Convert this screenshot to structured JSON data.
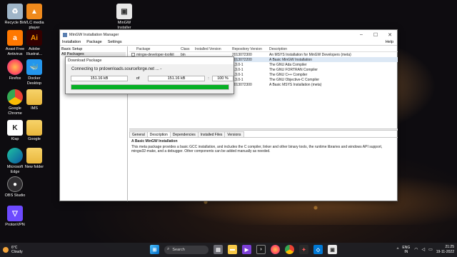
{
  "desktop": {
    "icons": [
      {
        "label": "Recycle Bin"
      },
      {
        "label": "VLC media player"
      },
      {
        "label": "MinGW Installer"
      },
      {
        "label": "Avast Free Antivirus"
      },
      {
        "label": "Adobe Illustrat..."
      },
      {
        "label": "Firefox"
      },
      {
        "label": "Docker Desktop"
      },
      {
        "label": "Google Chrome"
      },
      {
        "label": "IMS"
      },
      {
        "label": "Microsoft Edge"
      },
      {
        "label": "Google"
      },
      {
        "label": "Klap"
      },
      {
        "label": "Microsoft Edge"
      },
      {
        "label": "New folder"
      },
      {
        "label": "OBS Studio"
      },
      {
        "label": "ProtonVPN"
      }
    ]
  },
  "window": {
    "title": "MinGW Installation Manager",
    "menu": [
      "Installation",
      "Package",
      "Settings"
    ],
    "help": "Help",
    "left_items": [
      "Basic Setup",
      "All Packages"
    ],
    "columns": [
      "Package",
      "Class",
      "Installed Version",
      "Repository Version",
      "Description"
    ],
    "rows": [
      {
        "package": "mingw-developer-toolkit",
        "class": "bin",
        "installed": "",
        "repo": "2013072300",
        "desc": "An MSYS Installation for MinGW Developers (meta)"
      },
      {
        "package": "",
        "class": "",
        "installed": "",
        "repo": "2013072200",
        "desc": "A Basic MinGW Installation"
      },
      {
        "package": "",
        "class": "",
        "installed": "",
        "repo": "6.3.0-1",
        "desc": "The GNU Ada Compiler"
      },
      {
        "package": "",
        "class": "",
        "installed": "",
        "repo": "6.3.0-1",
        "desc": "The GNU FORTRAN Compiler"
      },
      {
        "package": "",
        "class": "",
        "installed": "",
        "repo": "6.3.0-1",
        "desc": "The GNU C++ Compiler"
      },
      {
        "package": "",
        "class": "",
        "installed": "",
        "repo": "6.3.0-1",
        "desc": "The GNU Objective-C Compiler"
      },
      {
        "package": "",
        "class": "",
        "installed": "",
        "repo": "2013072300",
        "desc": "A Basic MSYS Installation (meta)"
      }
    ],
    "tabs": [
      "General",
      "Description",
      "Dependencies",
      "Installed Files",
      "Versions"
    ],
    "desc_title": "A Basic MinGW Installation",
    "desc_body": "This meta package provides a basic GCC installation, and includes the C compiler, linker and other binary tools, the runtime libraries and windows API support, mingw32-make, and a debugger. Other components can be added manually as needed."
  },
  "dialog": {
    "title": "Download Package",
    "connecting": "Connecting to prdownloads.sourceforge.net ... -",
    "downloaded": "151.16 kB",
    "of": "of",
    "total": "151.16 kB",
    "colon": ":",
    "percent": "100 %",
    "progress_fraction": 1.0,
    "progress_color": "#06b025"
  },
  "taskbar": {
    "temp": "6°C",
    "condition": "Cloudy",
    "search": "Search",
    "lang1": "ENG",
    "lang2": "IN",
    "time": "21:25",
    "date": "19-11-2022"
  }
}
